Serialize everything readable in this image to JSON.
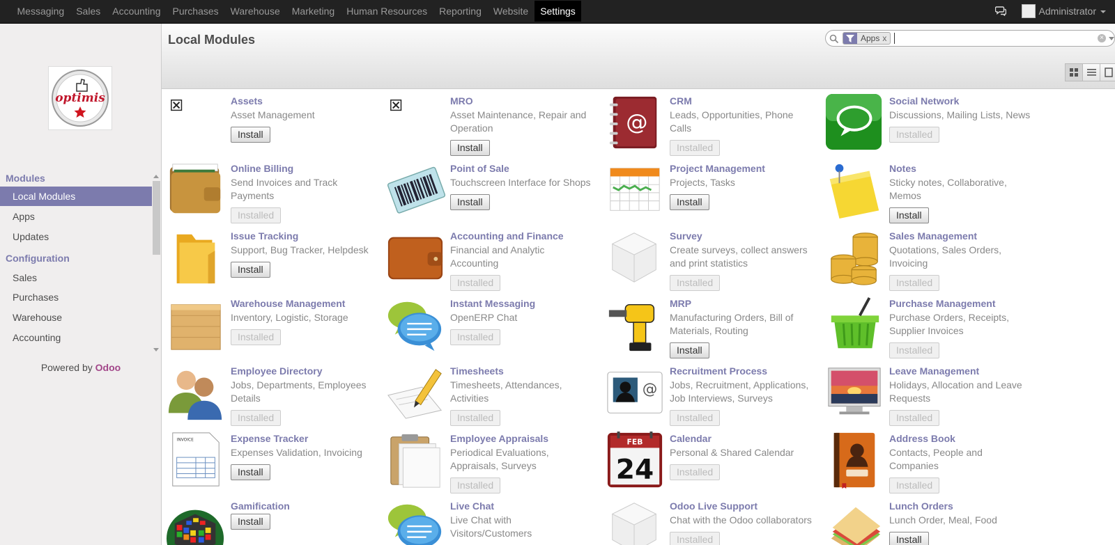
{
  "topbar": {
    "menu": [
      "Messaging",
      "Sales",
      "Accounting",
      "Purchases",
      "Warehouse",
      "Marketing",
      "Human Resources",
      "Reporting",
      "Website",
      "Settings"
    ],
    "active_menu": "Settings",
    "user": "Administrator"
  },
  "sidebar": {
    "sections": [
      {
        "title": "Modules",
        "items": [
          "Local Modules",
          "Apps",
          "Updates"
        ]
      },
      {
        "title": "Configuration",
        "items": [
          "Sales",
          "Purchases",
          "Warehouse",
          "Accounting"
        ]
      }
    ],
    "active_item": "Local Modules",
    "powered_by": "Powered by",
    "powered_brand": "Odoo"
  },
  "header": {
    "title": "Local Modules",
    "search_facet": "Apps",
    "search_facet_remove": "x",
    "view_modes": [
      "kanban",
      "list",
      "form"
    ]
  },
  "modules": [
    {
      "name": "Assets",
      "summary": "Asset Management",
      "state": "Install",
      "icon": "broken-image-icon"
    },
    {
      "name": "MRO",
      "summary": "Asset Maintenance, Repair and Operation",
      "state": "Install",
      "icon": "broken-image-icon"
    },
    {
      "name": "CRM",
      "summary": "Leads, Opportunities, Phone Calls",
      "state": "Installed",
      "icon": "address-book-at-icon"
    },
    {
      "name": "Social Network",
      "summary": "Discussions, Mailing Lists, News",
      "state": "Installed",
      "icon": "speech-bubble-icon"
    },
    {
      "name": "Online Billing",
      "summary": "Send Invoices and Track Payments",
      "state": "Installed",
      "icon": "wallet-icon"
    },
    {
      "name": "Point of Sale",
      "summary": "Touchscreen Interface for Shops",
      "state": "Install",
      "icon": "barcode-icon"
    },
    {
      "name": "Project Management",
      "summary": "Projects, Tasks",
      "state": "Install",
      "icon": "calendar-chart-icon"
    },
    {
      "name": "Notes",
      "summary": "Sticky notes, Collaborative, Memos",
      "state": "Install",
      "icon": "sticky-note-icon"
    },
    {
      "name": "Issue Tracking",
      "summary": "Support, Bug Tracker, Helpdesk",
      "state": "Install",
      "icon": "folder-icon"
    },
    {
      "name": "Accounting and Finance",
      "summary": "Financial and Analytic Accounting",
      "state": "Installed",
      "icon": "leather-wallet-icon"
    },
    {
      "name": "Survey",
      "summary": "Create surveys, collect answers and print statistics",
      "state": "Installed",
      "icon": "cube-icon"
    },
    {
      "name": "Sales Management",
      "summary": "Quotations, Sales Orders, Invoicing",
      "state": "Installed",
      "icon": "coins-icon"
    },
    {
      "name": "Warehouse Management",
      "summary": "Inventory, Logistic, Storage",
      "state": "Installed",
      "icon": "crate-icon"
    },
    {
      "name": "Instant Messaging",
      "summary": "OpenERP Chat",
      "state": "Installed",
      "icon": "chat-bubbles-icon"
    },
    {
      "name": "MRP",
      "summary": "Manufacturing Orders, Bill of Materials, Routing",
      "state": "Install",
      "icon": "drill-icon"
    },
    {
      "name": "Purchase Management",
      "summary": "Purchase Orders, Receipts, Supplier Invoices",
      "state": "Installed",
      "icon": "basket-icon"
    },
    {
      "name": "Employee Directory",
      "summary": "Jobs, Departments, Employees Details",
      "state": "Installed",
      "icon": "people-icon"
    },
    {
      "name": "Timesheets",
      "summary": "Timesheets, Attendances, Activities",
      "state": "Installed",
      "icon": "pencil-paper-icon"
    },
    {
      "name": "Recruitment Process",
      "summary": "Jobs, Recruitment, Applications, Job Interviews, Surveys",
      "state": "Installed",
      "icon": "contact-card-icon"
    },
    {
      "name": "Leave Management",
      "summary": "Holidays, Allocation and Leave Requests",
      "state": "Installed",
      "icon": "monitor-sunset-icon"
    },
    {
      "name": "Expense Tracker",
      "summary": "Expenses Validation, Invoicing",
      "state": "Install",
      "icon": "invoice-icon"
    },
    {
      "name": "Employee Appraisals",
      "summary": "Periodical Evaluations, Appraisals, Surveys",
      "state": "Installed",
      "icon": "clipboard-icon"
    },
    {
      "name": "Calendar",
      "summary": "Personal & Shared Calendar",
      "state": "Installed",
      "icon": "calendar-icon",
      "icon_month": "FEB",
      "icon_day": "24"
    },
    {
      "name": "Address Book",
      "summary": "Contacts, People and Companies",
      "state": "Installed",
      "icon": "contact-book-icon"
    },
    {
      "name": "Gamification",
      "summary": "",
      "state": "Install",
      "icon": "rubik-cube-icon"
    },
    {
      "name": "Live Chat",
      "summary": "Live Chat with Visitors/Customers",
      "state": "Install",
      "icon": "chat-bubbles-icon"
    },
    {
      "name": "Odoo Live Support",
      "summary": "Chat with the Odoo collaborators",
      "state": "Installed",
      "icon": "cube-icon"
    },
    {
      "name": "Lunch Orders",
      "summary": "Lunch Order, Meal, Food",
      "state": "Install",
      "icon": "sandwich-icon"
    }
  ],
  "colors": {
    "topbar": "#222222",
    "accent": "#7c7bad",
    "brand": "#a24689",
    "sidebar_bg": "#f0eeee"
  }
}
